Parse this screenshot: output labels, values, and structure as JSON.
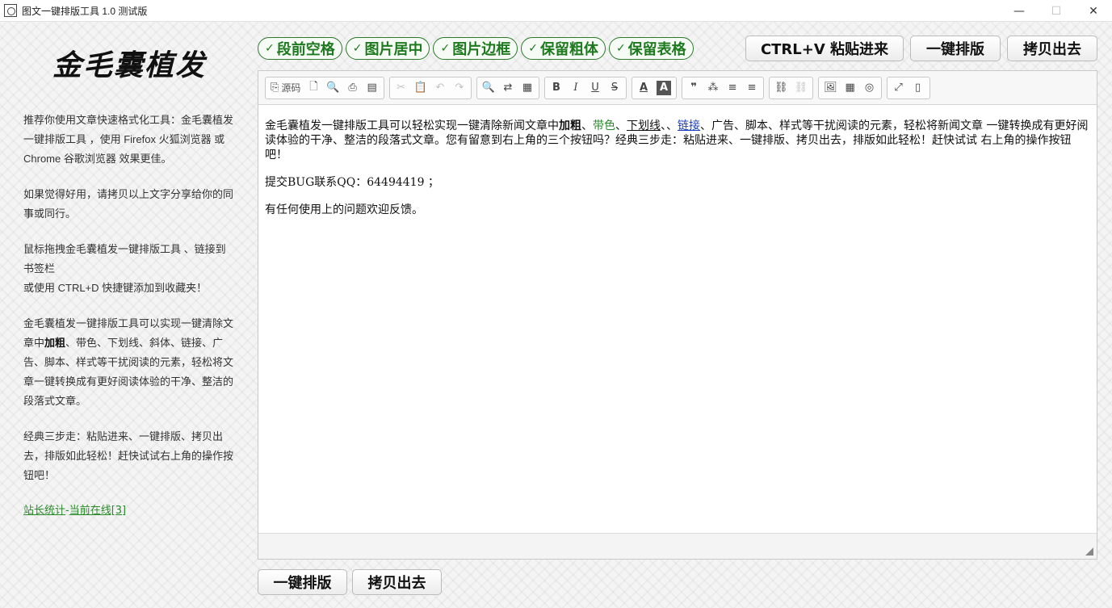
{
  "window": {
    "title": "图文一键排版工具 1.0 测试版",
    "controls": {
      "minimize": "—",
      "maximize": "☐",
      "close": "✕"
    }
  },
  "sidebar": {
    "logo_text": "金毛囊植发",
    "para1": "推荐你使用文章快速格式化工具：金毛囊植发一键排版工具 ，使用 Firefox 火狐浏览器 或 Chrome 谷歌浏览器 效果更佳。",
    "para2": "如果觉得好用，请拷贝以上文字分享给你的同事或同行。",
    "para3_line1": "鼠标拖拽金毛囊植发一键排版工具 、链接到书签栏",
    "para3_line2": "或使用 CTRL+D 快捷键添加到收藏夹！",
    "para4_pre": "金毛囊植发一键排版工具可以实现一键清除文章中",
    "para4_bold": "加粗",
    "para4_post": "、带色、下划线、斜体、链接、广告、脚本、样式等干扰阅读的元素，轻松将文章一键转换成有更好阅读体验的干净、整洁的段落式文章。",
    "para5": "经典三步走：粘贴进来、一键排版、拷贝出去，排版如此轻松！赶快试试右上角的操作按钮吧！",
    "link_stats": "站长统计",
    "link_sep": "-",
    "link_online": "当前在线[3]"
  },
  "options": [
    {
      "check": "✓",
      "label": "段前空格"
    },
    {
      "check": "✓",
      "label": "图片居中"
    },
    {
      "check": "✓",
      "label": "图片边框"
    },
    {
      "check": "✓",
      "label": "保留粗体"
    },
    {
      "check": "✓",
      "label": "保留表格"
    }
  ],
  "actions": {
    "paste": "CTRL+V 粘贴进来",
    "format": "一键排版",
    "copy": "拷贝出去"
  },
  "toolbar": {
    "source_label": "源码",
    "icons": {
      "source": "⎘",
      "new_page": "🗋",
      "preview": "🔍",
      "print": "⎙",
      "templates": "▤",
      "cut": "✂",
      "paste": "📋",
      "undo": "↶",
      "redo": "↷",
      "find": "🔍",
      "replace": "⇄",
      "format_clear": "▦",
      "bold": "B",
      "italic": "I",
      "underline": "U",
      "strike": "S",
      "text_color": "A",
      "bg_color": "A",
      "quote": "❞",
      "format_block": "⁂",
      "align_left": "≡",
      "align_right": "≡",
      "link": "⛓",
      "unlink": "⛓",
      "image": "🖼",
      "table": "▦",
      "globe": "◎",
      "maximize": "⤢",
      "show_blocks": "▯"
    }
  },
  "editor": {
    "p1_a": "金毛囊植发一键排版工具可以轻松实现一键清除新闻文章中",
    "p1_bold": "加粗",
    "p1_b": "、",
    "p1_green": "带色",
    "p1_c": "、",
    "p1_underline": "下划线",
    "p1_d": "、、",
    "p1_link": "链接",
    "p1_e": "、广告、脚本、样式等干扰阅读的元素，轻松将新闻文章 一键转换成有更好阅读体验的干净、整洁的段落式文章。您有留意到右上角的三个按钮吗？经典三步走：粘贴进来、一键排版、拷贝出去，排版如此轻松！赶快试试 右上角的操作按钮吧！",
    "p2": "提交BUG联系QQ：64494419 ；",
    "p3": "有任何使用上的问题欢迎反馈。"
  },
  "bottom": {
    "format": "一键排版",
    "copy": "拷贝出去"
  }
}
